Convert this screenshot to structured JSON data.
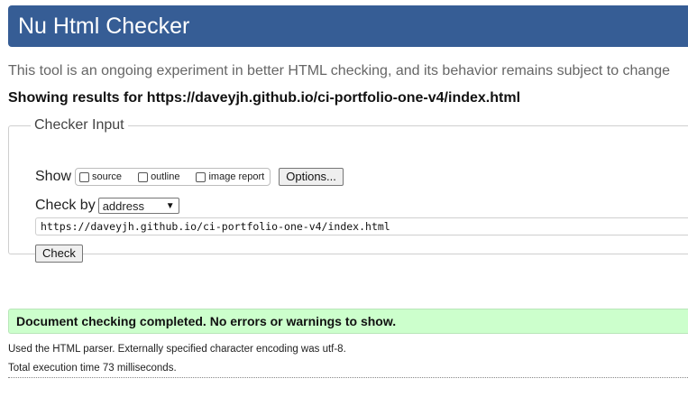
{
  "header": {
    "title": "Nu Html Checker"
  },
  "subtitle": "This tool is an ongoing experiment in better HTML checking, and its behavior remains subject to change",
  "results_for": "Showing results for https://daveyjh.github.io/ci-portfolio-one-v4/index.html",
  "checker_input": {
    "legend": "Checker Input",
    "show_label": "Show",
    "show_options": [
      {
        "label": "source",
        "checked": false
      },
      {
        "label": "outline",
        "checked": false
      },
      {
        "label": "image report",
        "checked": false
      }
    ],
    "options_button": "Options...",
    "check_by_label": "Check by",
    "check_by_value": "address",
    "url_value": "https://daveyjh.github.io/ci-portfolio-one-v4/index.html",
    "check_button": "Check"
  },
  "result": {
    "message": "Document checking completed. No errors or warnings to show.",
    "status_color": "#ccffcc"
  },
  "details": {
    "parser_line": "Used the HTML parser. Externally specified character encoding was utf-8.",
    "time_line": "Total execution time 73 milliseconds."
  },
  "colors": {
    "header_bg": "#365d95",
    "header_text": "#ffffff",
    "success_bg": "#ccffcc"
  },
  "icons": {
    "select_caret": "chevron-down-icon"
  }
}
